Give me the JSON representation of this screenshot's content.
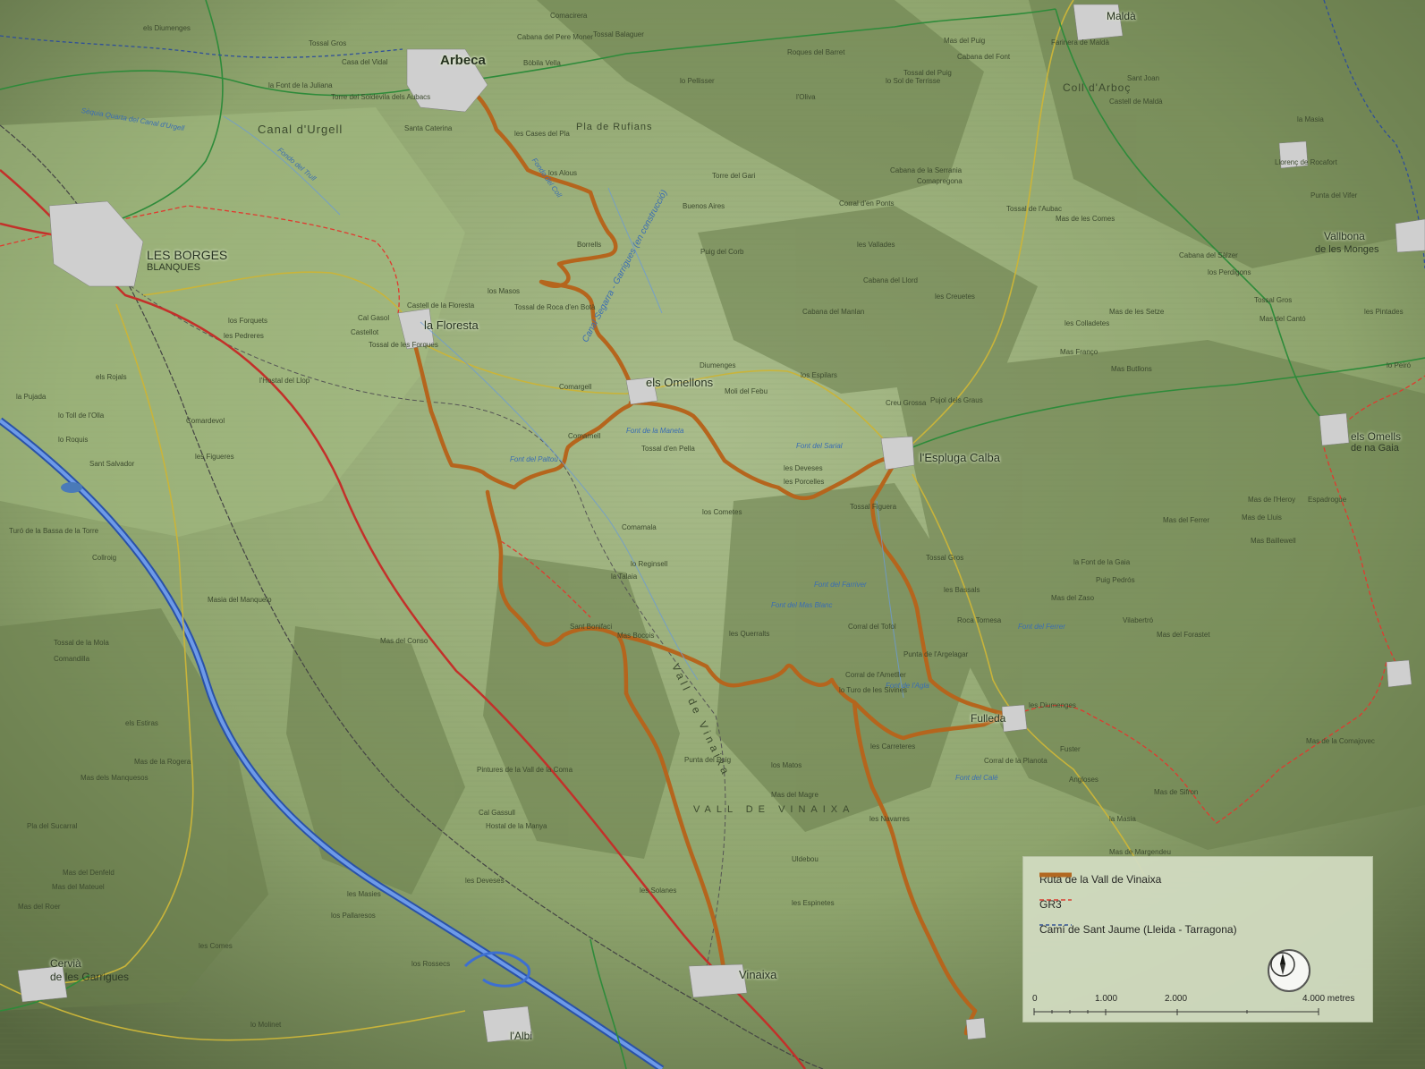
{
  "towns": {
    "arbeca": "Arbeca",
    "les_borges_1": "LES BORGES",
    "les_borges_2": "BLANQUES",
    "la_floresta": "la Floresta",
    "els_omellons": "els Omellons",
    "espluga_calba": "l'Espluga Calba",
    "fulleda": "Fulleda",
    "vinaixa": "Vinaixa",
    "cervia_1": "Cervià",
    "cervia_2": "de les Garrigues",
    "lalbi": "l'Albi",
    "malda": "Maldà",
    "vallbona_1": "Vallbona",
    "vallbona_2": "de les Monges",
    "omells_1": "els Omells",
    "omells_2": "de na Gaia"
  },
  "areas": {
    "canal_urgell": "Canal d'Urgell",
    "pla_rufians": "Pla de Rufians",
    "coll_arboc": "Coll d'Arboç",
    "vall_vinaixa": "VALL DE VINAIXA",
    "vall_de_vinaixa_diag": "Vall de Vinaixa"
  },
  "places": [
    "els Diumenges",
    "Tossal Gros",
    "Casa del Vidal",
    "la Font de la Juliana",
    "Torre del Soldevila dels Aubacs",
    "Comacirera",
    "Cabana del Pere Moner",
    "Tossal Balaguer",
    "Bòbila Vella",
    "Santa Caterina",
    "les Cases del Pla",
    "los Alous",
    "Borrells",
    "Tossal de Roca d'en Botà",
    "los Masos",
    "Cal Gasol",
    "Castell de la Floresta",
    "Tossal de les Forques",
    "Castellot",
    "les Pedreres",
    "l'Hostal del Llop",
    "els Rojals",
    "la Pujada",
    "lo Toll de l'Olla",
    "lo Roquis",
    "Comardevol",
    "les Figueres",
    "Sant Salvador",
    "Turó de la Bassa de la Torre",
    "Collroig",
    "Masia del Manquelo",
    "Tossal de la Mola",
    "Comandilla",
    "Mas del Conso",
    "els Estiras",
    "Mas de la Rogera",
    "Pla del Sucarral",
    "Mas dels Manquesos",
    "Mas del Denfeld",
    "Mas del Mateuel",
    "Mas del Roer",
    "los Forquets",
    "Comargell",
    "Comarnell",
    "Tossal d'en Pella",
    "Moli del Febu",
    "Diumenges",
    "los Espilars",
    "les Deveses",
    "les Porcelles",
    "los Cometes",
    "lo Reginsell",
    "la Talaia",
    "Sant Bonifaci",
    "Mas Bocois",
    "les Querralts",
    "Corral del Tofol",
    "Punta de l'Argelagar",
    "Corral de l'Ametller",
    "lo Turo de les Sivines",
    "les Carreteres",
    "Punta del Puig",
    "los Matos",
    "Mas del Magre",
    "Uldebou",
    "les Espinetes",
    "les Navarres",
    "Cal Gassull",
    "Hostal de la Manya",
    "Pintures de la Vall de la Coma",
    "les Solanes",
    "les Deveses",
    "los Pallaresos",
    "les Masies",
    "les Comes",
    "los Rossecs",
    "lo Molinet",
    "Comamala",
    "Tossal Gros",
    "les Bassals",
    "Roca Tornesa",
    "Mas del Forastet",
    "Tossal Figuera",
    "Creu Grossa",
    "Pujol dels Graus",
    "Mas Franço",
    "Mas Butllons",
    "Cabana del Sàlzer",
    "Tossal del Puig",
    "Cabana de la Serrania",
    "Comapregona",
    "Mas de les Comes",
    "Tossal de l'Aubac",
    "Corral d'en Ponts",
    "les Vallades",
    "lo Pellisser",
    "l'Oliva",
    "Roques del Barret",
    "Torre del Gari",
    "Buenos Aires",
    "Puig del Corb",
    "Cabana del Llord",
    "Cabana del Manlan",
    "les Creuetes",
    "les Colladetes",
    "Mas de les Setze",
    "Mas del Puig",
    "Cabana del Font",
    "Farinera de Maldà",
    "lo Sol de Terrisse",
    "Castell de Maldà",
    "Sant Joan",
    "la Masia",
    "Llorenç de Rocafort",
    "Punta del Vifer",
    "les Pintades",
    "Mas del Cantó",
    "Tossal Gros",
    "los Perdigons",
    "lo Peiró",
    "Mas del Ferrer",
    "Mas de Lluis",
    "Mas Baillewell",
    "la Font de la Gaia",
    "Puig Pedrós",
    "Mas del Zaso",
    "Vilabertró",
    "Corral de la Planota",
    "Fuster",
    "Angloses",
    "les Diumenges",
    "Mas de l'Heroy",
    "Espadrogue",
    "la Masia",
    "Mas de Margendeu",
    "Mas de Sifron",
    "Mas de la Comajovec"
  ],
  "water": {
    "canal_seg": "Canal Segarra - Garrigues (en construcció)",
    "sequia": "Sèquia Quarta del Canal d'Urgell",
    "fondo_troll": "Fondo del Trull",
    "fondo_coll": "Fondo del Coll",
    "fonts": [
      "Font del Paltou",
      "Font de la Maneta",
      "Font del Mas Blanc",
      "Font de l'Agla",
      "Font del Sarial",
      "Font del Farriver",
      "Font del Ferrer",
      "Font del Calé"
    ]
  },
  "legend": {
    "items": [
      {
        "label": "Ruta de la Vall de Vinaixa",
        "style": "solid",
        "color": "#b5651d"
      },
      {
        "label": "GR3",
        "style": "dashed",
        "color": "#e03a2f"
      },
      {
        "label": "Camí de Sant Jaume (Lleida - Tarragona)",
        "style": "dashed",
        "color": "#2f4f99"
      }
    ],
    "scale_labels": [
      "0",
      "1.000",
      "2.000",
      "4.000 metres"
    ]
  },
  "colors": {
    "terrain": "#8fa56f",
    "route": "#b5651d",
    "gr3": "#e03a2f",
    "cami": "#2f4f99",
    "main_road": "#d0342c",
    "secondary_road": "#c9b43a",
    "green_road": "#2e8b3a",
    "highway": "#3d6fd1",
    "railway": "#444444",
    "urban": "#d9d9d9"
  }
}
